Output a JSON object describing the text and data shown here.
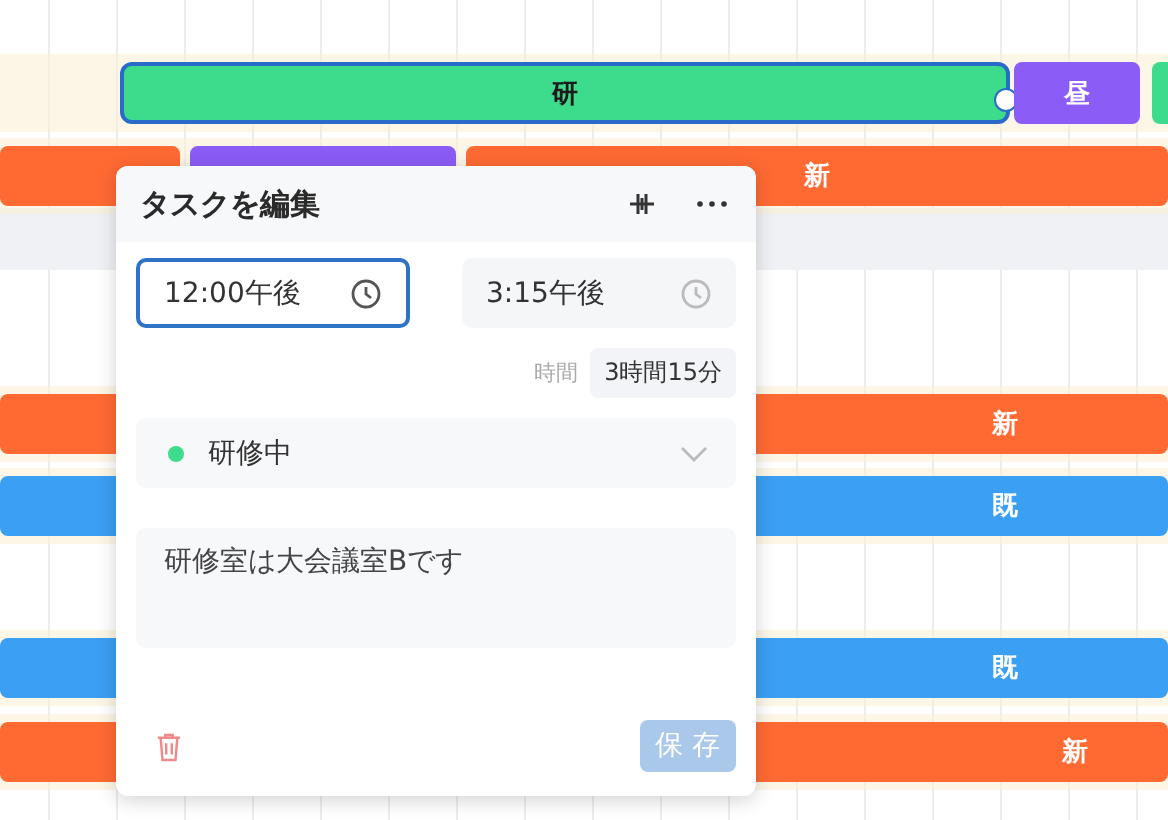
{
  "timeline": {
    "rows": [
      {
        "bars": [
          {
            "label": "研",
            "color": "#3ddc8c",
            "selected": true
          },
          {
            "label": "昼",
            "color": "#8b5cf6",
            "selected": false
          },
          {
            "color": "#3ddc8c",
            "selected": false
          }
        ]
      },
      {
        "bars": [
          {
            "color": "#ff6a33",
            "selected": false
          },
          {
            "color": "#8b5cf6",
            "selected": false
          },
          {
            "label": "新",
            "color": "#ff6a33",
            "selected": false
          }
        ]
      },
      {
        "bars": [
          {
            "label": "新",
            "color": "#ff6a33",
            "selected": false
          }
        ]
      },
      {
        "bars": [
          {
            "label": "既",
            "color": "#3b9ff3",
            "selected": false
          }
        ]
      },
      {
        "bars": [
          {
            "label": "既",
            "color": "#3b9ff3",
            "selected": false
          }
        ]
      },
      {
        "bars": [
          {
            "label": "新",
            "color": "#ff6a33",
            "selected": false
          }
        ]
      }
    ]
  },
  "editor": {
    "title": "タスクを編集",
    "start_time": {
      "value": "12:00午後",
      "focused": true
    },
    "end_time": {
      "value": "3:15午後",
      "focused": false
    },
    "duration": {
      "label": "時間",
      "value": "3時間15分"
    },
    "status": {
      "label": "研修中",
      "color": "#3ddc8c"
    },
    "notes": {
      "value": "研修室は大会議室Bです"
    },
    "save_button": {
      "label": "保 存",
      "disabled": true
    }
  }
}
